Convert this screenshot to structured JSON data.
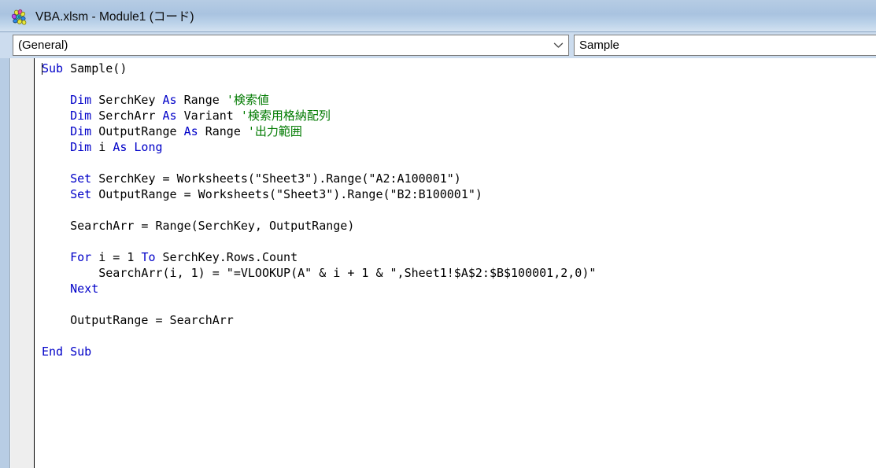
{
  "window": {
    "title": "VBA.xlsm - Module1 (コード)",
    "icon": "vba-module-icon"
  },
  "toolbar": {
    "object_combo": {
      "value": "(General)",
      "arrow_icon": "chevron-down-icon"
    },
    "procedure_combo": {
      "value": "Sample"
    }
  },
  "code": {
    "lines": [
      [
        {
          "t": "Sub ",
          "c": "kw"
        },
        {
          "t": "Sample()",
          "c": "pl"
        }
      ],
      [],
      [
        {
          "t": "    ",
          "c": "pl"
        },
        {
          "t": "Dim ",
          "c": "kw"
        },
        {
          "t": "SerchKey ",
          "c": "pl"
        },
        {
          "t": "As ",
          "c": "kw"
        },
        {
          "t": "Range ",
          "c": "pl"
        },
        {
          "t": "'検索値",
          "c": "cm"
        }
      ],
      [
        {
          "t": "    ",
          "c": "pl"
        },
        {
          "t": "Dim ",
          "c": "kw"
        },
        {
          "t": "SerchArr ",
          "c": "pl"
        },
        {
          "t": "As ",
          "c": "kw"
        },
        {
          "t": "Variant ",
          "c": "pl"
        },
        {
          "t": "'検索用格納配列",
          "c": "cm"
        }
      ],
      [
        {
          "t": "    ",
          "c": "pl"
        },
        {
          "t": "Dim ",
          "c": "kw"
        },
        {
          "t": "OutputRange ",
          "c": "pl"
        },
        {
          "t": "As ",
          "c": "kw"
        },
        {
          "t": "Range ",
          "c": "pl"
        },
        {
          "t": "'出力範囲",
          "c": "cm"
        }
      ],
      [
        {
          "t": "    ",
          "c": "pl"
        },
        {
          "t": "Dim ",
          "c": "kw"
        },
        {
          "t": "i ",
          "c": "pl"
        },
        {
          "t": "As ",
          "c": "kw"
        },
        {
          "t": "Long",
          "c": "kw"
        }
      ],
      [],
      [
        {
          "t": "    ",
          "c": "pl"
        },
        {
          "t": "Set ",
          "c": "kw"
        },
        {
          "t": "SerchKey = Worksheets(\"Sheet3\").Range(\"A2:A100001\")",
          "c": "pl"
        }
      ],
      [
        {
          "t": "    ",
          "c": "pl"
        },
        {
          "t": "Set ",
          "c": "kw"
        },
        {
          "t": "OutputRange = Worksheets(\"Sheet3\").Range(\"B2:B100001\")",
          "c": "pl"
        }
      ],
      [],
      [
        {
          "t": "    SearchArr = Range(SerchKey, OutputRange)",
          "c": "pl"
        }
      ],
      [],
      [
        {
          "t": "    ",
          "c": "pl"
        },
        {
          "t": "For ",
          "c": "kw"
        },
        {
          "t": "i = 1 ",
          "c": "pl"
        },
        {
          "t": "To ",
          "c": "kw"
        },
        {
          "t": "SerchKey.Rows.Count",
          "c": "pl"
        }
      ],
      [
        {
          "t": "        SearchArr(i, 1) = \"=VLOOKUP(A\" & i + 1 & \",Sheet1!$A$2:$B$100001,2,0)\"",
          "c": "pl"
        }
      ],
      [
        {
          "t": "    ",
          "c": "pl"
        },
        {
          "t": "Next",
          "c": "kw"
        }
      ],
      [],
      [
        {
          "t": "    OutputRange = SearchArr",
          "c": "pl"
        }
      ],
      [],
      [
        {
          "t": "End Sub",
          "c": "kw"
        }
      ]
    ]
  },
  "colors": {
    "keyword": "#0000c8",
    "comment": "#007a00",
    "plain": "#000000",
    "titlebar": "#a9c3e0",
    "left_strip": "#b8cde4",
    "gutter": "#eeeeee"
  }
}
